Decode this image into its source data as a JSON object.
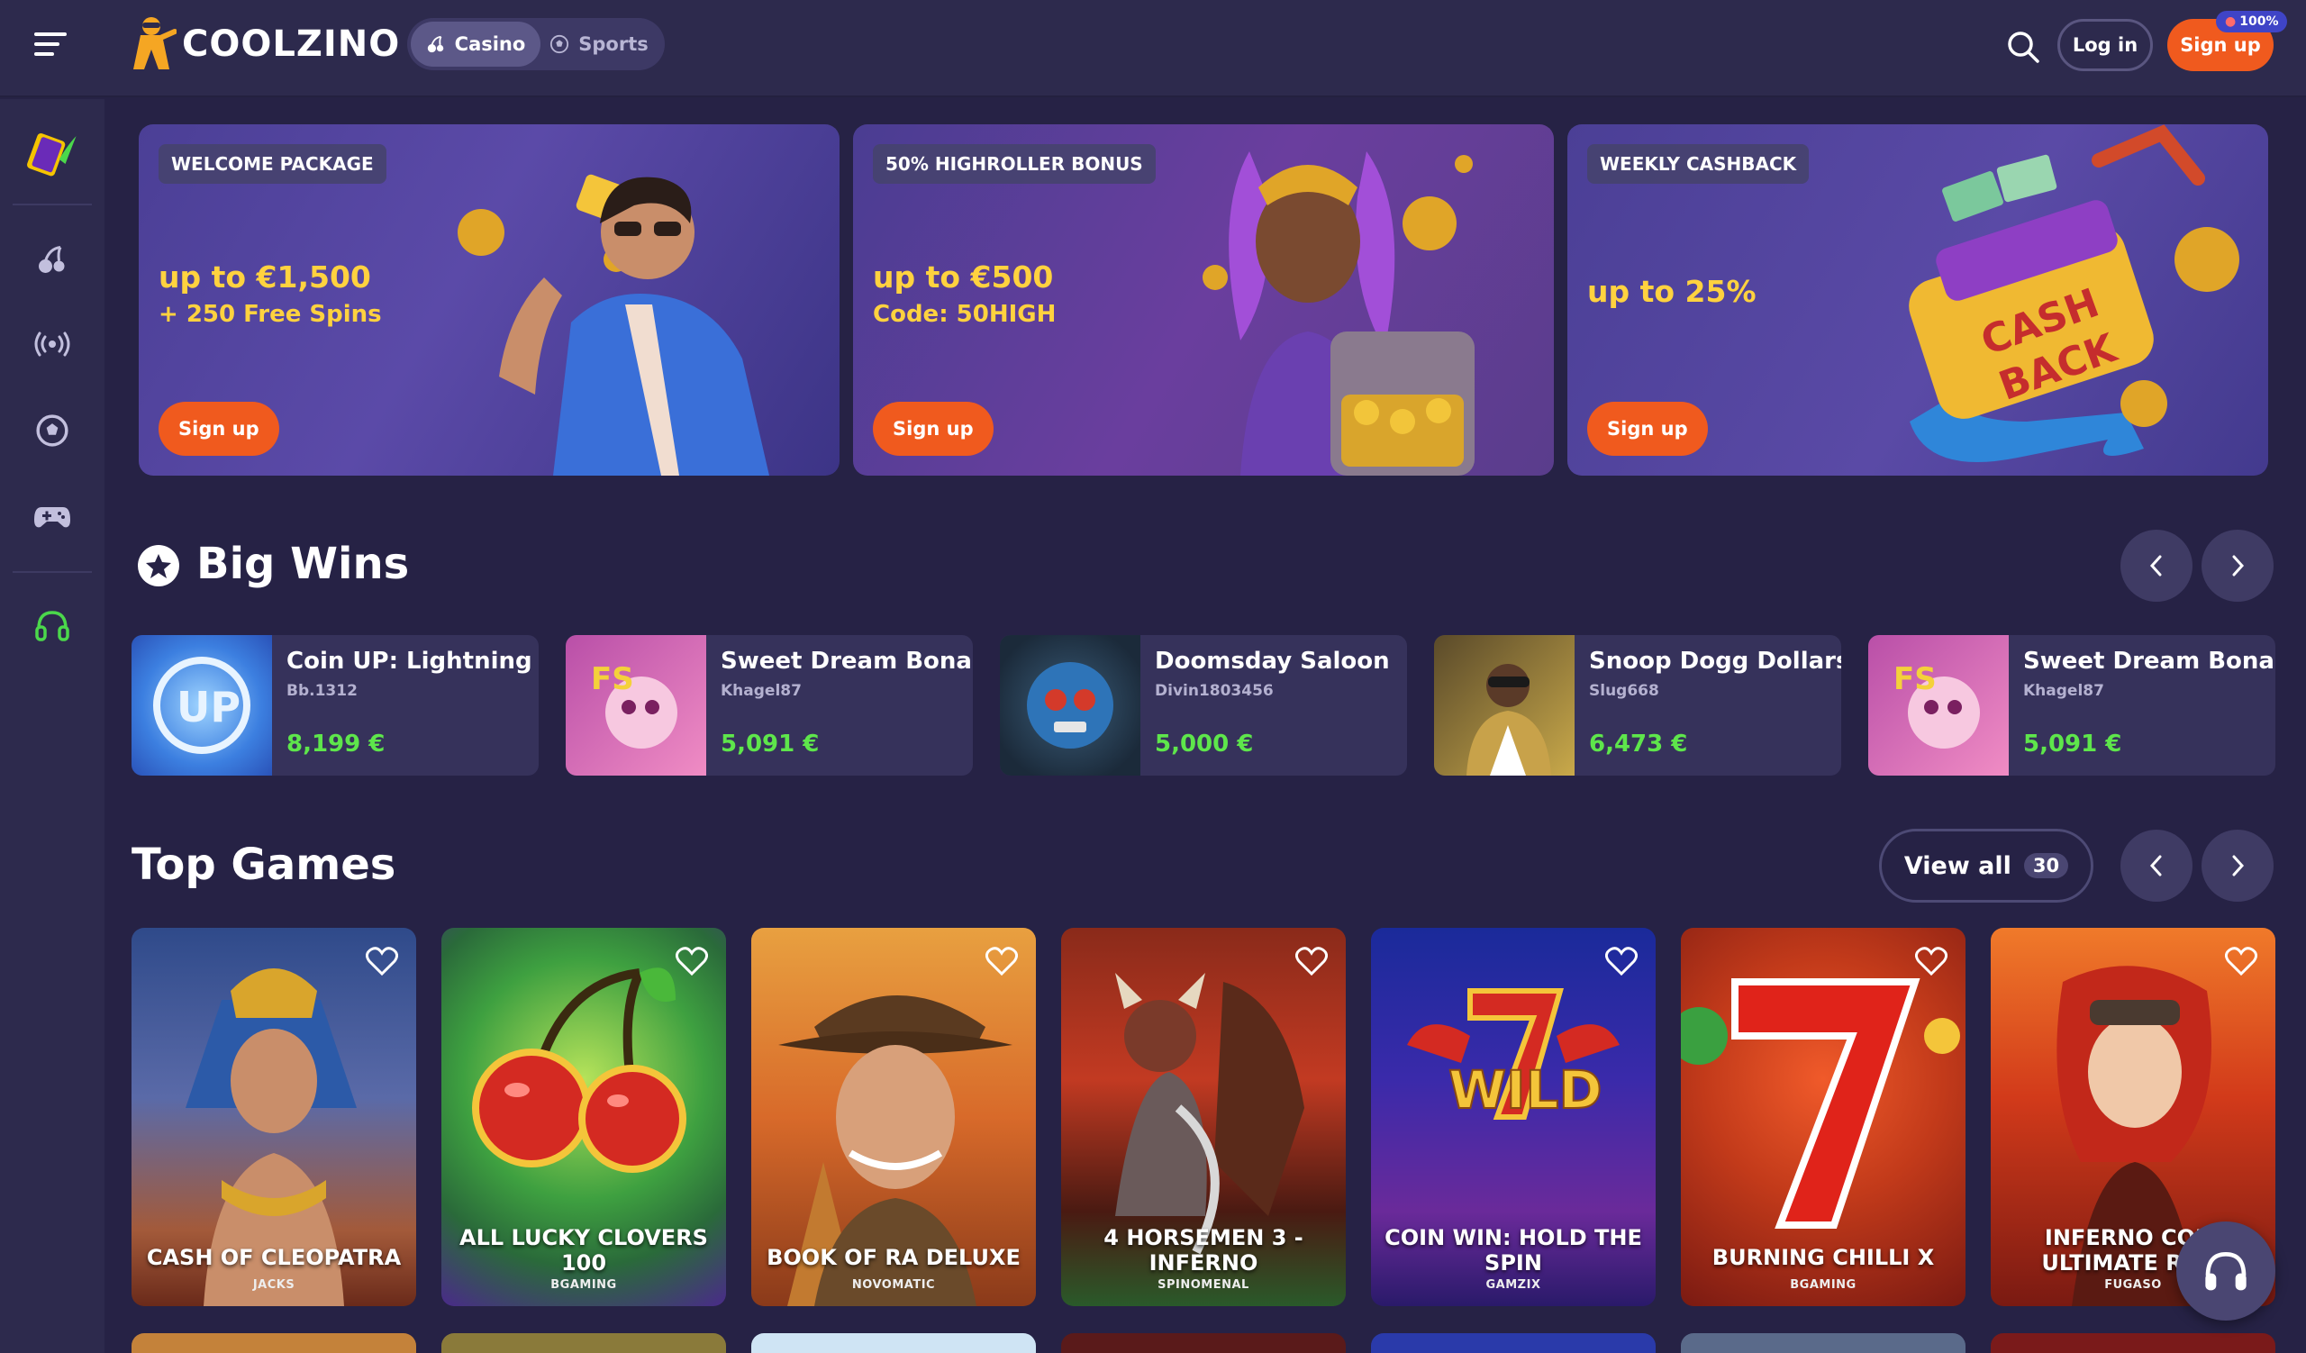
{
  "header": {
    "logo_text": "COOLZINO",
    "modes": [
      {
        "label": "Casino",
        "icon": "cherry-icon",
        "active": true
      },
      {
        "label": "Sports",
        "icon": "soccer-ball-icon",
        "active": false
      }
    ],
    "login_label": "Log in",
    "signup_label": "Sign up",
    "signup_badge": "100%"
  },
  "sidebar": {
    "items": [
      {
        "name": "promo-card-icon"
      },
      {
        "name": "casino-cherry-icon"
      },
      {
        "name": "live-broadcast-icon"
      },
      {
        "name": "sports-ball-icon"
      },
      {
        "name": "gamepad-icon"
      },
      {
        "name": "support-headphones-icon"
      }
    ]
  },
  "promos": [
    {
      "tag": "WELCOME PACKAGE",
      "line1": "up to €1,500",
      "line2": "+ 250 Free Spins",
      "button": "Sign up"
    },
    {
      "tag": "50% HIGHROLLER BONUS",
      "line1": "up to €500",
      "line2": "Code: 50HIGH",
      "button": "Sign up"
    },
    {
      "tag": "WEEKLY CASHBACK",
      "line1": "up to 25%",
      "line2": "",
      "button": "Sign up"
    }
  ],
  "big_wins": {
    "title": "Big Wins",
    "items": [
      {
        "game": "Coin UP: Lightning",
        "user": "Bb.1312",
        "amount": "8,199 €"
      },
      {
        "game": "Sweet Dream Bonanz...",
        "user": "Khagel87",
        "amount": "5,091 €"
      },
      {
        "game": "Doomsday Saloon",
        "user": "Divin1803456",
        "amount": "5,000 €"
      },
      {
        "game": "Snoop Dogg Dollars",
        "user": "Slug668",
        "amount": "6,473 €"
      },
      {
        "game": "Sweet Dream Bonanz...",
        "user": "Khagel87",
        "amount": "5,091 €"
      }
    ]
  },
  "top_games": {
    "title": "Top Games",
    "view_all_label": "View all",
    "view_all_count": "30",
    "items": [
      {
        "name": "CASH OF CLEOPATRA",
        "provider": "JACKS"
      },
      {
        "name": "ALL LUCKY CLOVERS 100",
        "provider": "BGAMING"
      },
      {
        "name": "BOOK OF RA DELUXE",
        "provider": "NOVOMATIC"
      },
      {
        "name": "4 HORSEMEN 3 - INFERNO",
        "provider": "SPINOMENAL"
      },
      {
        "name": "COIN WIN: HOLD THE SPIN",
        "provider": "GAMZIX"
      },
      {
        "name": "BURNING CHILLI X",
        "provider": "BGAMING"
      },
      {
        "name": "INFERNO COIN ULTIMATE RU...",
        "provider": "FUGASO"
      }
    ]
  },
  "colors": {
    "background": "#262245",
    "panel": "#2d2a4d",
    "accent": "#f05a1e",
    "win_green": "#5ee64b",
    "promo_yellow": "#ffd23f"
  }
}
